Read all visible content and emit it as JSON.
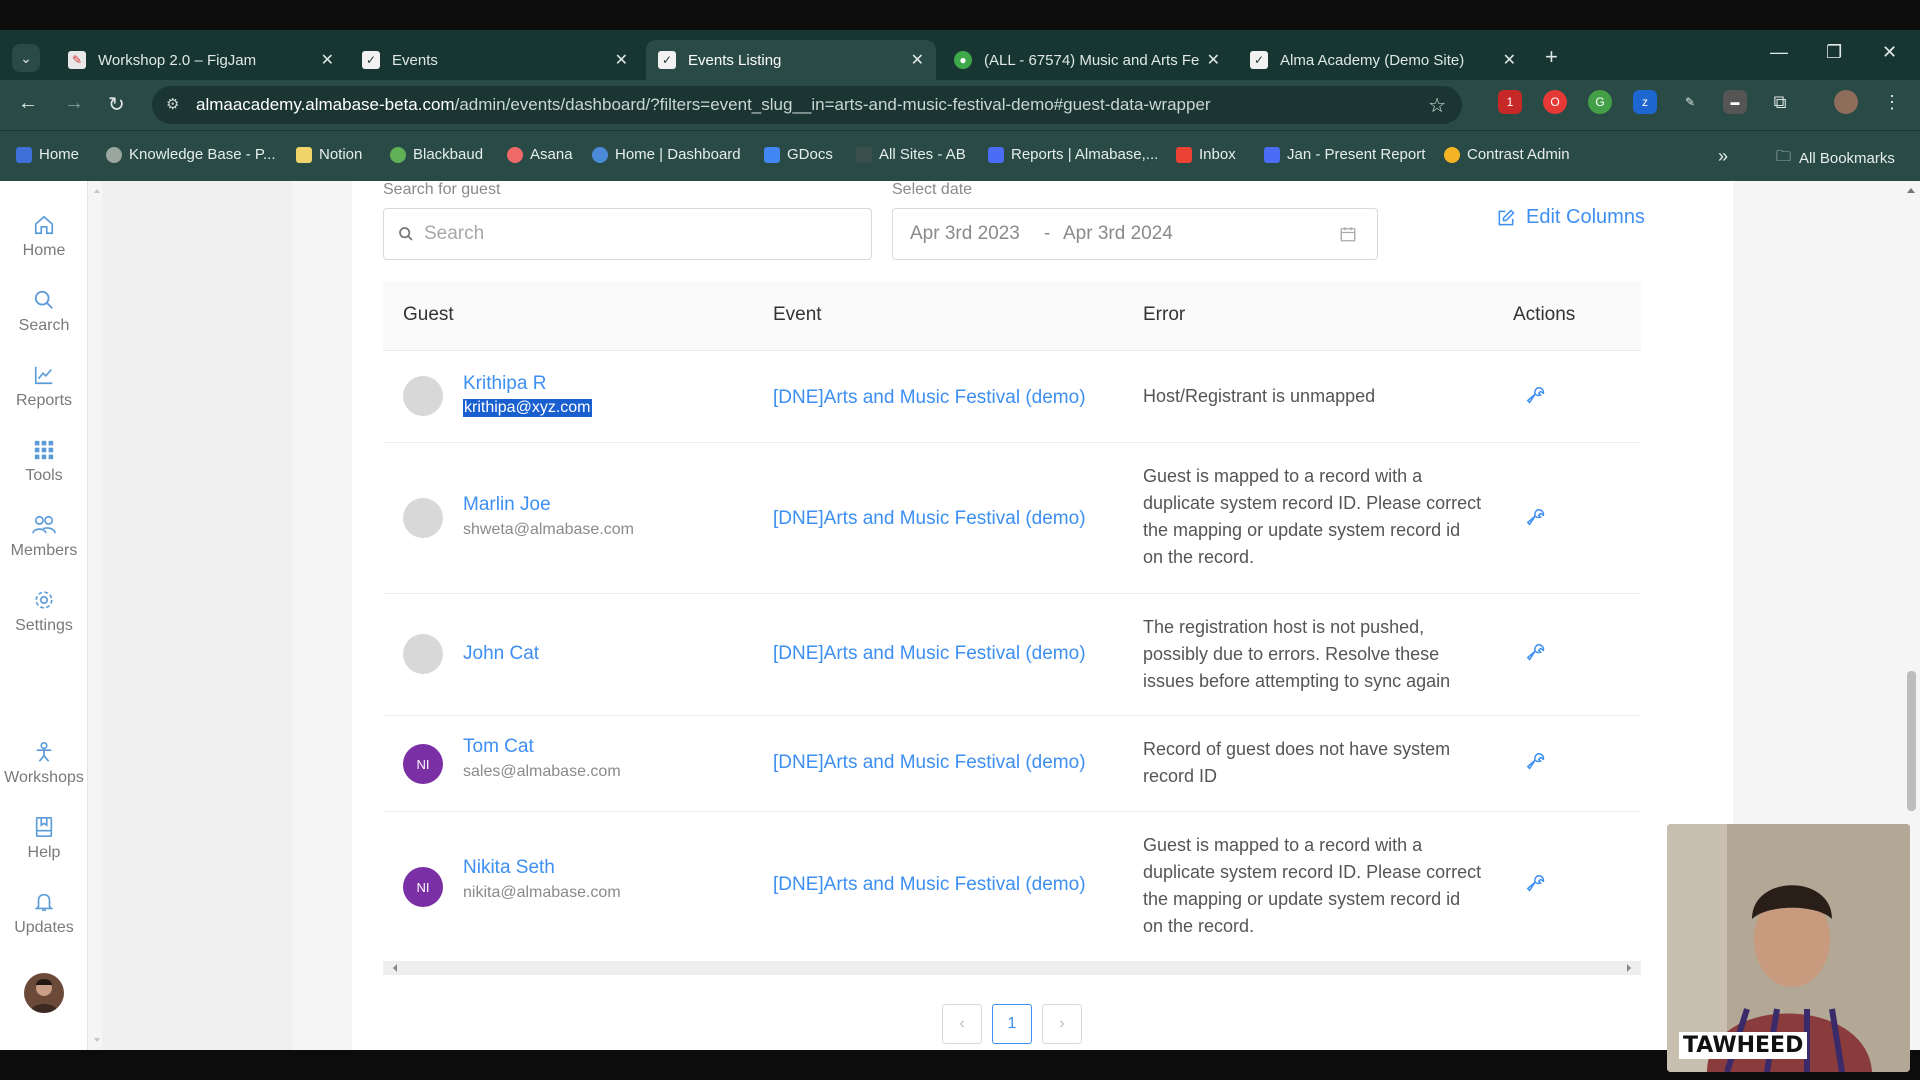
{
  "browser": {
    "tabs": [
      {
        "label": "Workshop 2.0 – FigJam",
        "active": false
      },
      {
        "label": "Events",
        "active": false
      },
      {
        "label": "Events Listing",
        "active": true
      },
      {
        "label": "(ALL - 67574) Music and Arts Fe",
        "active": false
      },
      {
        "label": "Alma Academy (Demo Site)",
        "active": false
      }
    ],
    "url_host": "almaacademy.almabase-beta.com",
    "url_path": "/admin/events/dashboard/?filters=event_slug__in=arts-and-music-festival-demo#guest-data-wrapper",
    "ext_badge": "1",
    "bookmarks": [
      "Home",
      "Knowledge Base - P...",
      "Notion",
      "Blackbaud",
      "Asana",
      "Home | Dashboard",
      "GDocs",
      "All Sites - AB",
      "Reports | Almabase,...",
      "Inbox",
      "Jan - Present Report",
      "Contrast Admin"
    ],
    "all_bookmarks": "All Bookmarks"
  },
  "sidebar": {
    "items": [
      {
        "label": "Home",
        "icon": "home-icon"
      },
      {
        "label": "Search",
        "icon": "search-icon"
      },
      {
        "label": "Reports",
        "icon": "chart-icon"
      },
      {
        "label": "Tools",
        "icon": "grid-icon"
      },
      {
        "label": "Members",
        "icon": "users-icon"
      },
      {
        "label": "Settings",
        "icon": "gear-icon"
      },
      {
        "label": "Workshops",
        "icon": "person-icon"
      },
      {
        "label": "Help",
        "icon": "book-icon"
      },
      {
        "label": "Updates",
        "icon": "bell-icon"
      }
    ]
  },
  "filters": {
    "search_label": "Search for guest",
    "search_placeholder": "Search",
    "date_label": "Select date",
    "date_from": "Apr 3rd 2023",
    "date_sep": "-",
    "date_to": "Apr 3rd 2024",
    "edit_columns": "Edit Columns"
  },
  "table": {
    "headers": {
      "guest": "Guest",
      "event": "Event",
      "error": "Error",
      "actions": "Actions"
    },
    "rows": [
      {
        "initials": "",
        "name": "Krithipa R",
        "email": "krithipa@xyz.com",
        "event": "[DNE]Arts and Music Festival (demo)",
        "error": "Host/Registrant is unmapped"
      },
      {
        "initials": "",
        "name": "Marlin Joe",
        "email": "shweta@almabase.com",
        "event": "[DNE]Arts and Music Festival (demo)",
        "error": "Guest is mapped to a record with a duplicate system record ID. Please correct the mapping or update system record id on the record."
      },
      {
        "initials": "",
        "name": "John Cat",
        "email": "",
        "event": "[DNE]Arts and Music Festival (demo)",
        "error": "The registration host is not pushed, possibly due to errors. Resolve these issues before attempting to sync again"
      },
      {
        "initials": "NI",
        "name": "Tom Cat",
        "email": "sales@almabase.com",
        "event": "[DNE]Arts and Music Festival (demo)",
        "error": "Record of guest does not have system record ID"
      },
      {
        "initials": "NI",
        "name": "Nikita Seth",
        "email": "nikita@almabase.com",
        "event": "[DNE]Arts and Music Festival (demo)",
        "error": "Guest is mapped to a record with a duplicate system record ID. Please correct the mapping or update system record id on the record."
      }
    ]
  },
  "pagination": {
    "prev": "‹",
    "current": "1",
    "next": "›"
  },
  "webcam": {
    "name": "TAWHEED"
  },
  "colors": {
    "accent": "#3d8ff2",
    "chrome": "#2a4a45",
    "avatar_purple": "#7b2fa4"
  }
}
